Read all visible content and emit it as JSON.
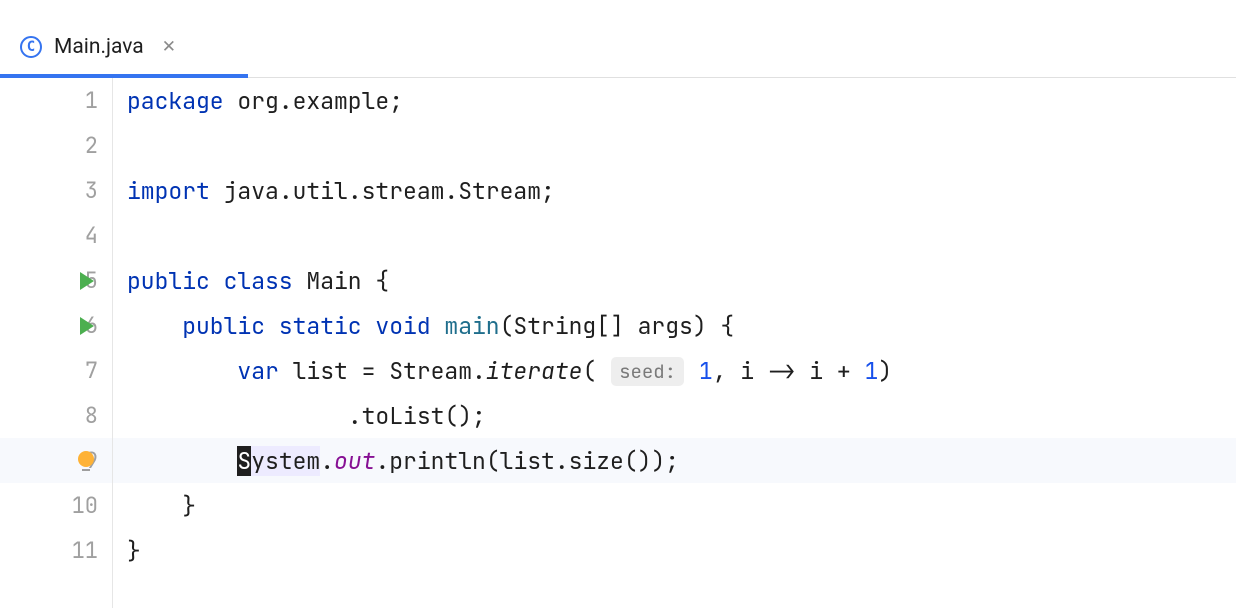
{
  "tab": {
    "file_icon_letter": "C",
    "filename": "Main.java"
  },
  "lines": {
    "l1_kw": "package",
    "l1_rest": " org.example;",
    "l3_kw": "import",
    "l3_rest": " java.util.stream.Stream;",
    "l5_kw1": "public class",
    "l5_name": " Main {",
    "l6_kw": "public static void",
    "l6_method": " main",
    "l6_params": "(String[] args) {",
    "l7_kw": "var",
    "l7_a": " list = Stream.",
    "l7_iterate": "iterate",
    "l7_open": "(",
    "l7_hint": "seed:",
    "l7_num1": "1",
    "l7_b": ", i -> i + ",
    "l7_num2": "1",
    "l7_c": ")",
    "l8_a": ".toList();",
    "l9_cursor": "S",
    "l9_sys": "ystem",
    "l9_dot": ".",
    "l9_out": "out",
    "l9_rest": ".println(list.size());",
    "l10_a": "}",
    "l11_a": "}"
  },
  "line_numbers": [
    "1",
    "2",
    "3",
    "4",
    "5",
    "6",
    "7",
    "8",
    "9",
    "10",
    "11"
  ]
}
